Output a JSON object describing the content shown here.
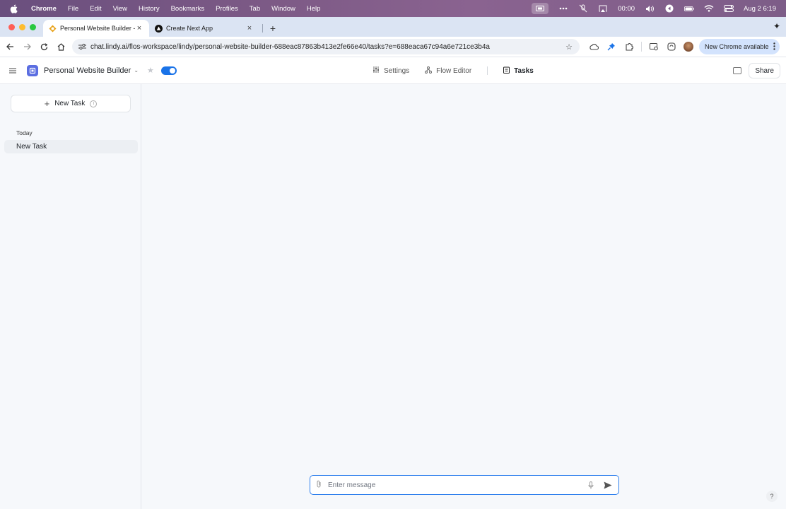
{
  "menubar": {
    "app": "Chrome",
    "items": [
      "File",
      "Edit",
      "View",
      "History",
      "Bookmarks",
      "Profiles",
      "Tab",
      "Window",
      "Help"
    ],
    "clock": "00:00",
    "date_time": "Aug 2  6:19"
  },
  "tabs": [
    {
      "title": "Personal Website Builder - N",
      "icon": "lindy-favicon",
      "active": true
    },
    {
      "title": "Create Next App",
      "icon": "vercel-favicon",
      "active": false
    }
  ],
  "toolbar": {
    "url": "chat.lindy.ai/flos-workspace/lindy/personal-website-builder-688eac87863b413e2fe66e40/tasks?e=688eaca67c94a6e721ce3b4a",
    "update_label": "New Chrome available"
  },
  "app_header": {
    "name": "Personal Website Builder",
    "tabs": [
      {
        "label": "Settings",
        "icon": "sliders-icon"
      },
      {
        "label": "Flow Editor",
        "icon": "flow-icon"
      },
      {
        "label": "Tasks",
        "icon": "clipboard-icon"
      }
    ],
    "share_label": "Share",
    "accent": "#1a73e8"
  },
  "sidebar": {
    "new_task_label": "New Task",
    "section_label": "Today",
    "tasks": [
      "New Task"
    ]
  },
  "composer": {
    "placeholder": "Enter message"
  },
  "help_label": "?"
}
